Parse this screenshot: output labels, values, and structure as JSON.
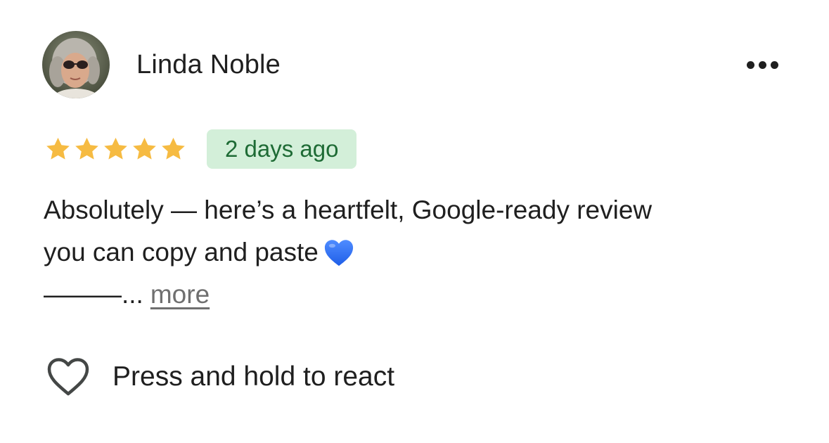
{
  "review": {
    "author": {
      "name": "Linda Noble",
      "avatar_icon": "user-avatar-photo"
    },
    "menu_icon": "more-horizontal-icon",
    "rating": {
      "value": 5,
      "max": 5,
      "star_color": "#f6bb42"
    },
    "date_label": "2 days ago",
    "date_badge_colors": {
      "background": "#d3efd9",
      "text": "#1e6b35"
    },
    "text_lines": [
      "Absolutely — here’s a heartfelt, Google-ready review",
      "you can copy and paste",
      "———..."
    ],
    "emoji_icon": "blue-heart-icon",
    "more_label": "more"
  },
  "reaction": {
    "icon": "heart-outline-icon",
    "label": "Press and hold to react"
  }
}
